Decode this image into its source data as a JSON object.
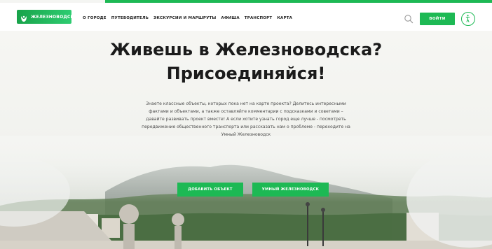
{
  "header": {
    "logo_text": "ЖЕЛЕЗНОВОДСК",
    "nav": [
      "О ГОРОДЕ",
      "ПУТЕВОДИТЕЛЬ",
      "ЭКСКУРСИИ И МАРШРУТЫ",
      "АФИША",
      "ТРАНСПОРТ",
      "КАРТА"
    ],
    "login_label": "ВОЙТИ"
  },
  "hero": {
    "title_line1": "Живешь в Железноводска?",
    "title_line2": "Присоединяйся!",
    "description": "Знаете классные объекты, которых пока нет на карте проекта? Делитесь интересными фактами и объектами, а также оставляйте комментарии с подсказками и советами – давайте развивать проект вместе! А если хотите узнать город еще лучше - посмотреть передвижение общественного транспорта или рассказать нам о проблеме - переходите на Умный Железноводск",
    "button_add": "ДОБАВИТЬ ОБЪЕКТ",
    "button_smart": "УМНЫЙ ЖЕЛЕЗНОВОДСК"
  },
  "colors": {
    "accent": "#1db954",
    "title": "#1b1b1b",
    "body_text": "#4a4a4a"
  },
  "icons": {
    "search": "search-icon",
    "accessibility": "accessibility-icon",
    "logo": "logo-mark-icon"
  }
}
